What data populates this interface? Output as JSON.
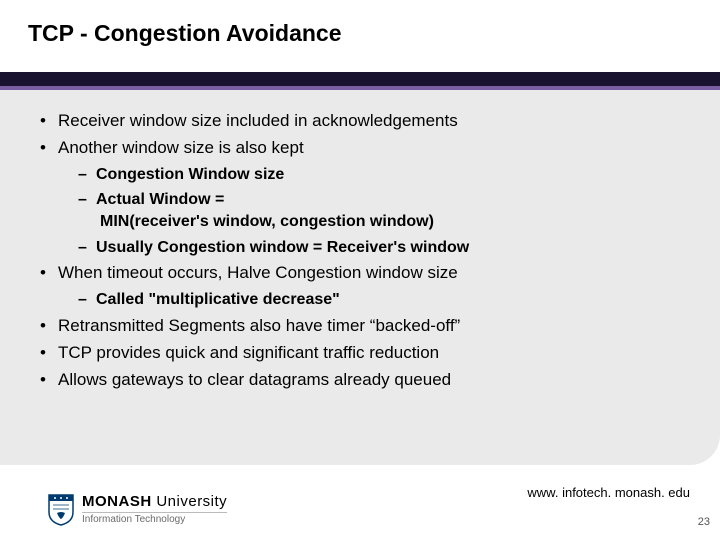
{
  "title": "TCP - Congestion Avoidance",
  "bullets": {
    "b1": "Receiver window size included in acknowledgements",
    "b2": "Another window size is also kept",
    "b2_1": "Congestion Window size",
    "b2_2a": "Actual Window =",
    "b2_2b": "MIN(receiver's window, congestion window)",
    "b2_3": "Usually Congestion window = Receiver's window",
    "b3": "When timeout occurs, Halve Congestion window size",
    "b3_1": "Called \"multiplicative decrease\"",
    "b4": "Retransmitted Segments also have timer “backed-off”",
    "b5": "TCP provides quick and significant traffic reduction",
    "b6": "Allows gateways to clear datagrams already queued"
  },
  "footer": {
    "url": "www. infotech. monash. edu",
    "page": "23",
    "logo_main_bold": "MONASH",
    "logo_main_rest": " University",
    "logo_sub": "Information Technology"
  }
}
